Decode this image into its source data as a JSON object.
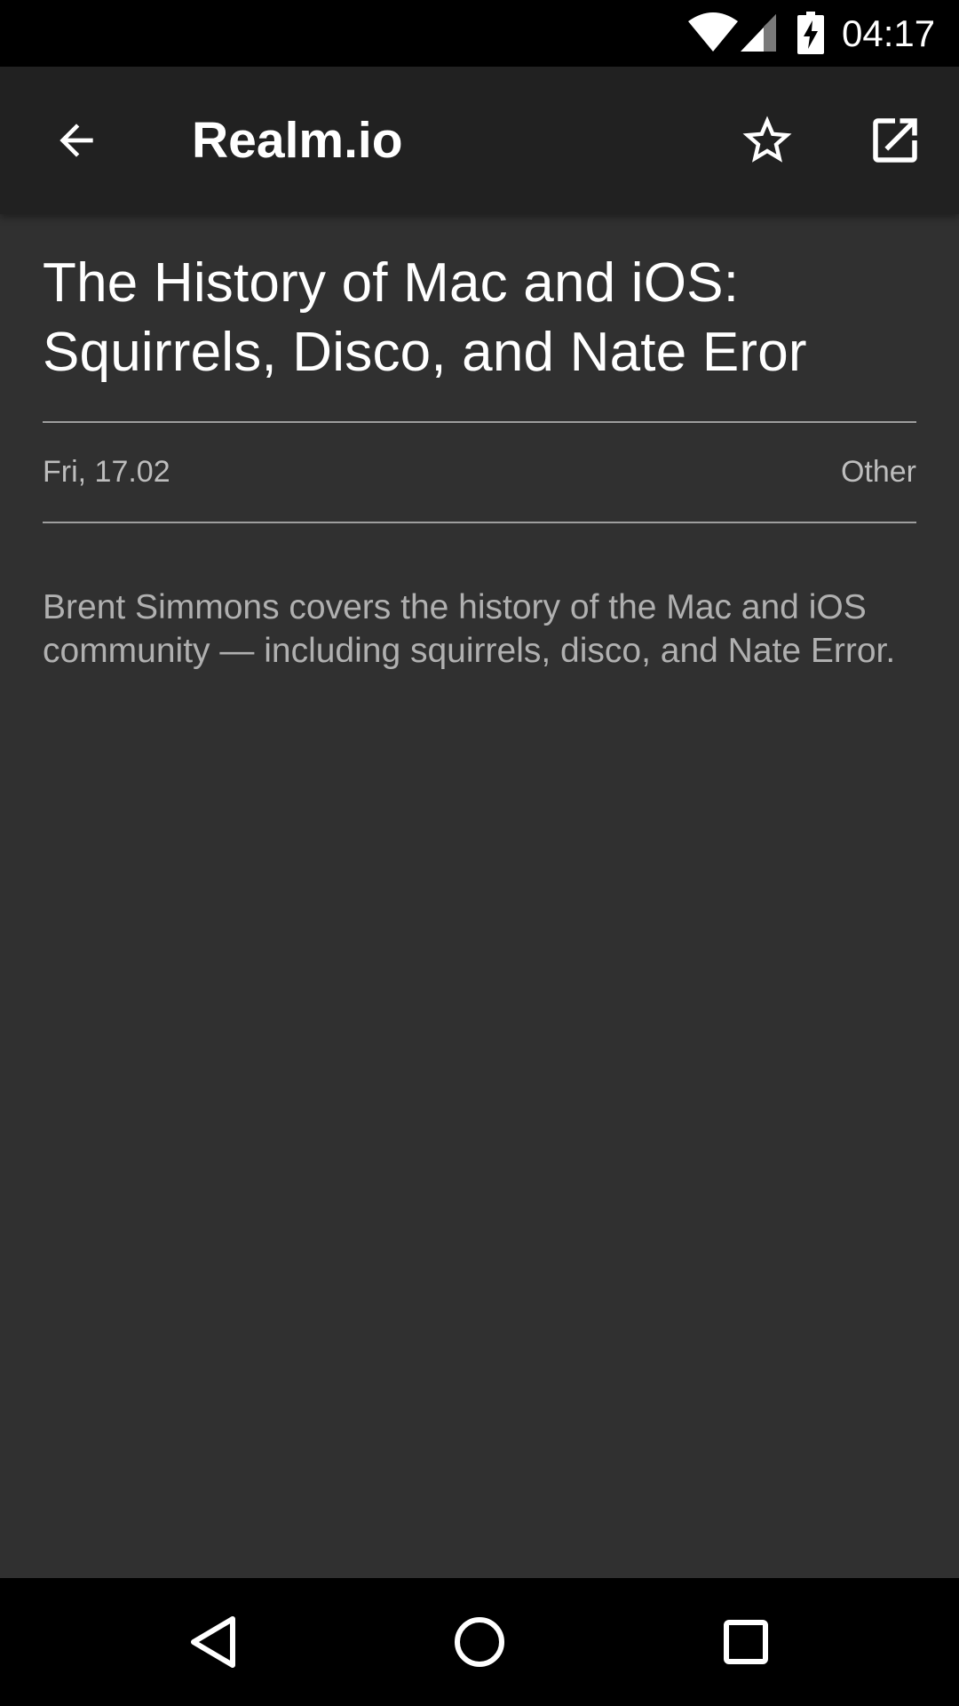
{
  "status_bar": {
    "time": "04:17",
    "icons": [
      "wifi-icon",
      "cell-signal-icon",
      "battery-charging-icon"
    ]
  },
  "app_bar": {
    "title": "Realm.io",
    "icons": [
      "arrow-back-icon",
      "star-outline-icon",
      "open-in-new-icon"
    ]
  },
  "article": {
    "title": "The History of Mac and iOS: Squirrels, Disco, and Nate Eror",
    "date": "Fri, 17.02",
    "category": "Other",
    "body": "Brent Simmons covers the history of the Mac and iOS community — including squirrels, disco, and Nate Error."
  },
  "nav_bar": {
    "icons": [
      "nav-back-icon",
      "nav-home-icon",
      "nav-recents-icon"
    ]
  },
  "colors": {
    "status_bar": "#000000",
    "app_bar": "#212121",
    "background": "#303030",
    "divider": "#9e9e9e",
    "text_primary": "#ffffff",
    "text_secondary": "#b0b0b0"
  }
}
